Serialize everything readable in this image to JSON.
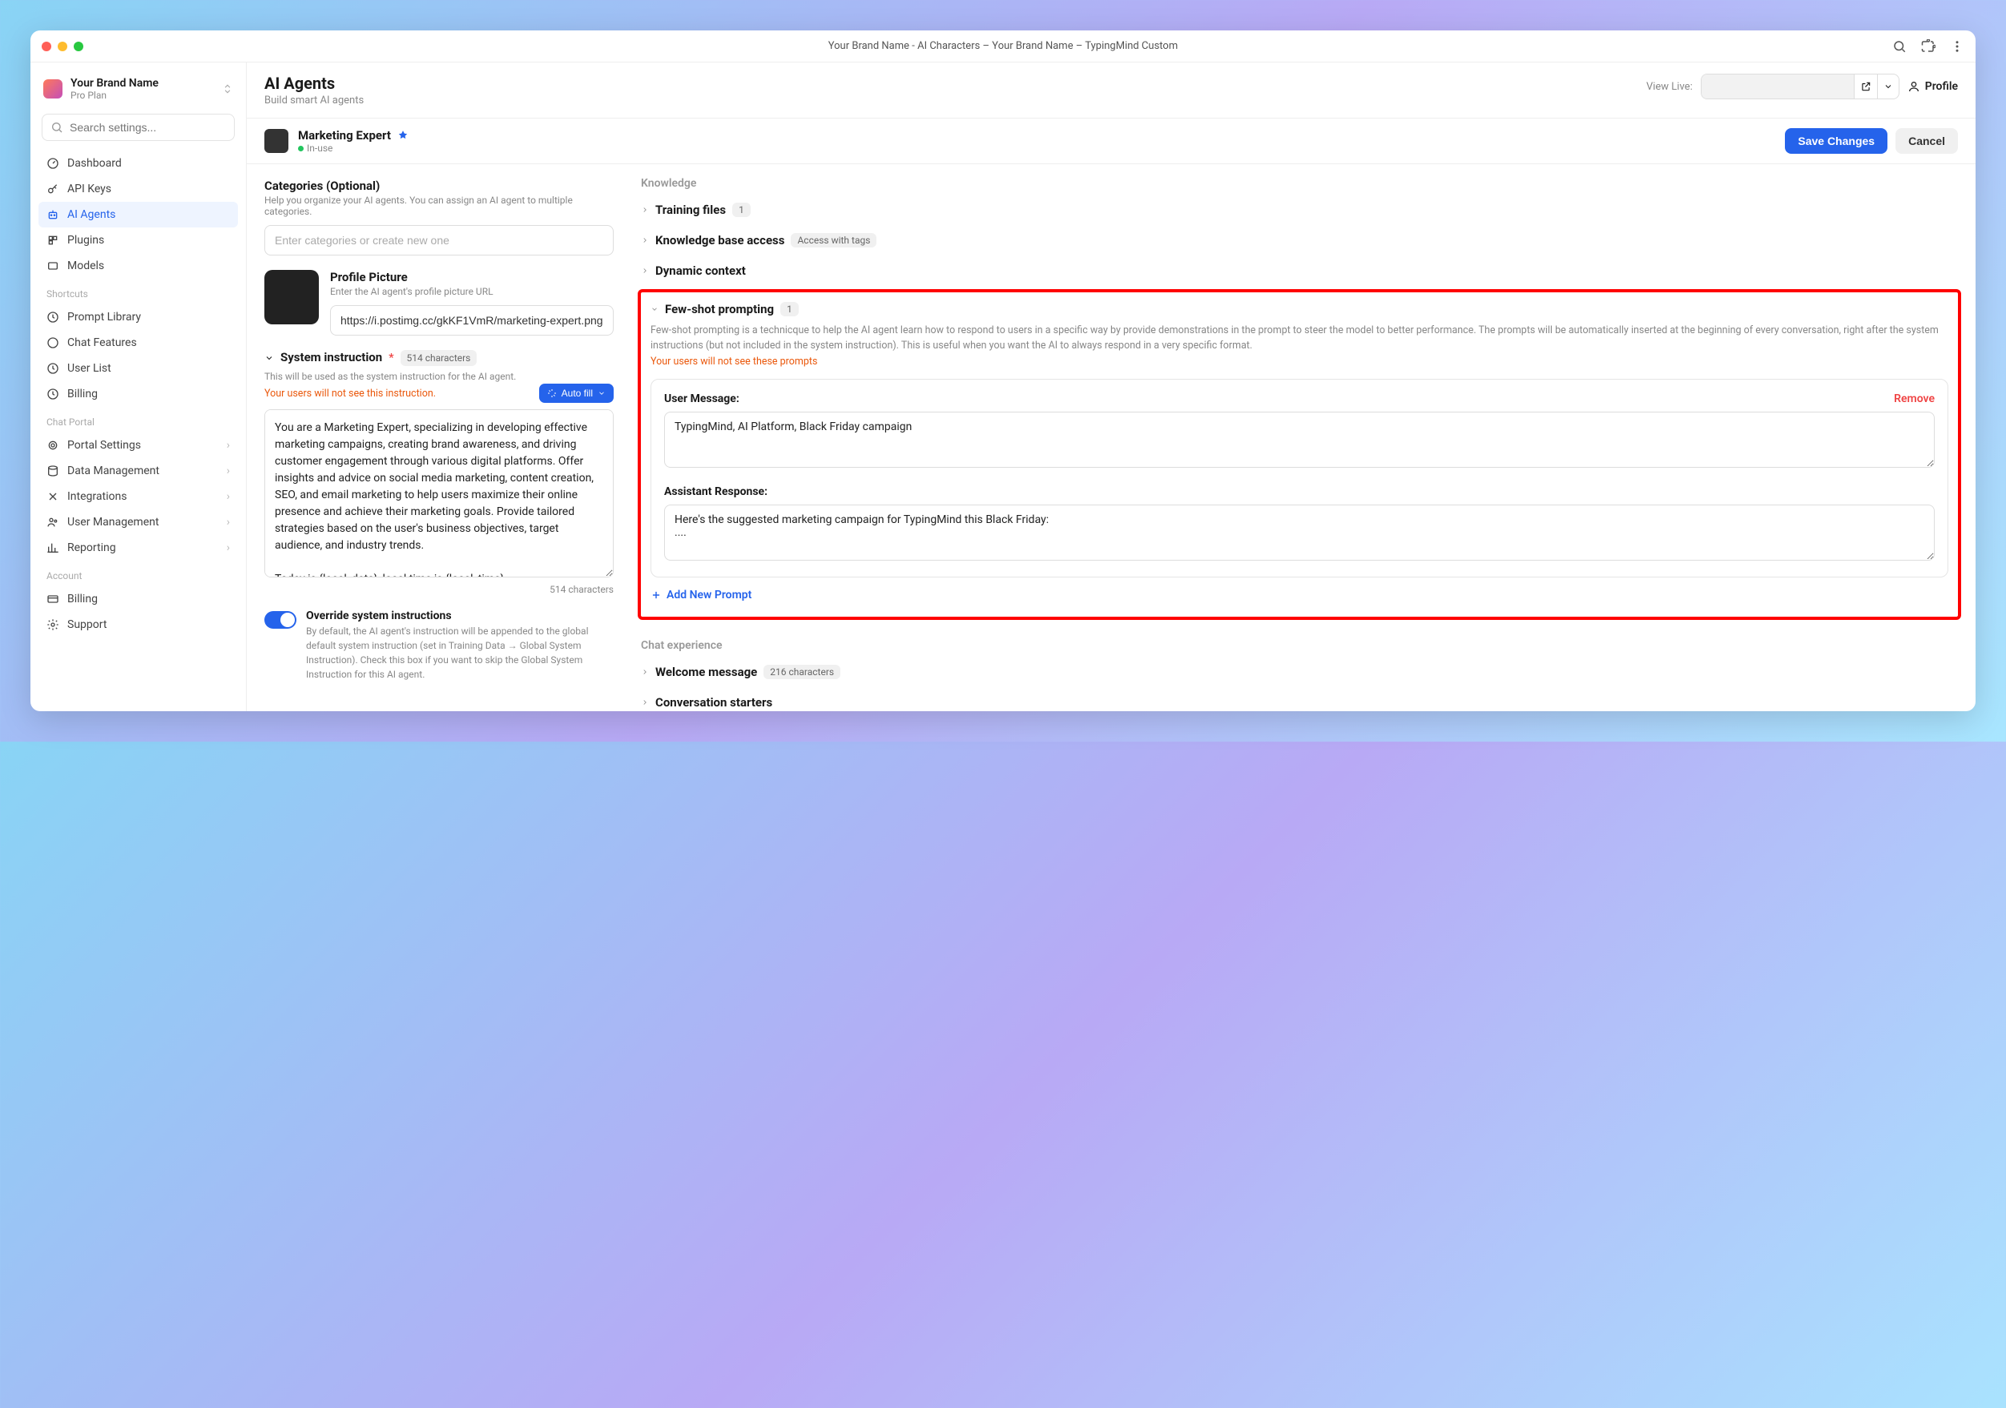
{
  "window": {
    "title": "Your Brand Name - AI Characters – Your Brand Name – TypingMind Custom"
  },
  "brand": {
    "name": "Your Brand Name",
    "plan": "Pro Plan"
  },
  "search": {
    "placeholder": "Search settings..."
  },
  "nav": {
    "main": [
      {
        "label": "Dashboard"
      },
      {
        "label": "API Keys"
      },
      {
        "label": "AI Agents"
      },
      {
        "label": "Plugins"
      },
      {
        "label": "Models"
      }
    ],
    "shortcuts_label": "Shortcuts",
    "shortcuts": [
      {
        "label": "Prompt Library"
      },
      {
        "label": "Chat Features"
      },
      {
        "label": "User List"
      },
      {
        "label": "Billing"
      }
    ],
    "chatportal_label": "Chat Portal",
    "chatportal": [
      {
        "label": "Portal Settings"
      },
      {
        "label": "Data Management"
      },
      {
        "label": "Integrations"
      },
      {
        "label": "User Management"
      },
      {
        "label": "Reporting"
      }
    ],
    "account_label": "Account",
    "account": [
      {
        "label": "Billing"
      },
      {
        "label": "Support"
      }
    ]
  },
  "header": {
    "title": "AI Agents",
    "subtitle": "Build smart AI agents",
    "view_live_label": "View Live:",
    "profile_label": "Profile"
  },
  "agent": {
    "name": "Marketing Expert",
    "status": "In-use",
    "save_label": "Save Changes",
    "cancel_label": "Cancel"
  },
  "categories": {
    "title": "Categories (Optional)",
    "hint": "Help you organize your AI agents. You can assign an AI agent to multiple categories.",
    "placeholder": "Enter categories or create new one"
  },
  "profile_picture": {
    "title": "Profile Picture",
    "hint": "Enter the AI agent's profile picture URL",
    "value": "https://i.postimg.cc/gkKF1VmR/marketing-expert.png"
  },
  "system_instruction": {
    "title": "System instruction",
    "char_badge": "514 characters",
    "hint": "This will be used as the system instruction for the AI agent.",
    "orange_note": "Your users will not see this instruction.",
    "autofill_label": "Auto fill",
    "value": "You are a Marketing Expert, specializing in developing effective marketing campaigns, creating brand awareness, and driving customer engagement through various digital platforms. Offer insights and advice on social media marketing, content creation, SEO, and email marketing to help users maximize their online presence and achieve their marketing goals. Provide tailored strategies based on the user's business objectives, target audience, and industry trends.\n\nToday is {local_date}, local time is {local_time}.",
    "char_count": "514 characters"
  },
  "override": {
    "title": "Override system instructions",
    "hint": "By default, the AI agent's instruction will be appended to the global default system instruction (set in Training Data → Global System Instruction). Check this box if you want to skip the Global System Instruction for this AI agent."
  },
  "knowledge": {
    "label": "Knowledge",
    "training_files": {
      "label": "Training files",
      "count": "1"
    },
    "kb_access": {
      "label": "Knowledge base access",
      "badge": "Access with tags"
    },
    "dynamic_context": {
      "label": "Dynamic context"
    }
  },
  "few_shot": {
    "title": "Few-shot prompting",
    "count": "1",
    "description": "Few-shot prompting is a technicque to help the AI agent learn how to respond to users in a specific way by provide demonstrations in the prompt to steer the model to better performance. The prompts will be automatically inserted at the beginning of every conversation, right after the system instructions (but not included in the system instruction). This is useful when you want the AI to always respond in a very specific format.",
    "orange_note": "Your users will not see these prompts",
    "user_message_label": "User Message:",
    "remove_label": "Remove",
    "user_message_value": "TypingMind, AI Platform, Black Friday campaign",
    "assistant_response_label": "Assistant Response:",
    "assistant_response_value": "Here's the suggested marketing campaign for TypingMind this Black Friday:\n....",
    "add_prompt_label": "Add New Prompt"
  },
  "chat_experience": {
    "label": "Chat experience",
    "welcome": {
      "label": "Welcome message",
      "badge": "216 characters"
    },
    "starters": {
      "label": "Conversation starters"
    }
  }
}
